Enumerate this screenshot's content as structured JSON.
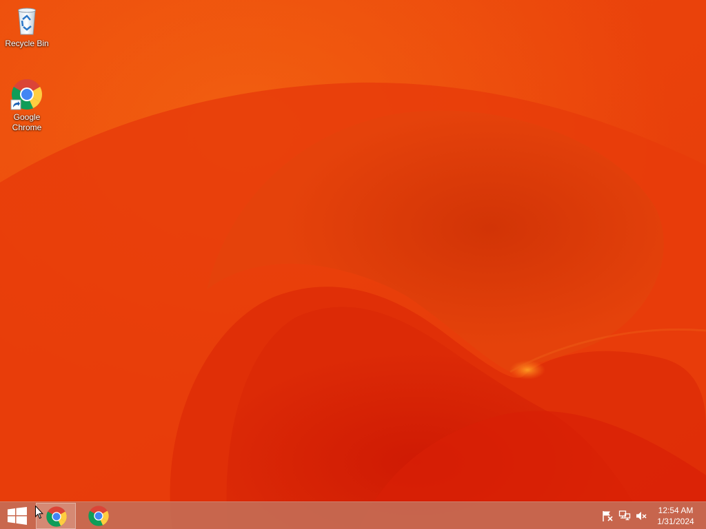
{
  "desktop": {
    "icons": [
      {
        "label": "Recycle Bin",
        "icon": "recycle-bin-icon"
      },
      {
        "label": "Google\nChrome",
        "icon": "chrome-icon",
        "shortcut": true
      }
    ],
    "wallpaper_colors": {
      "base": "#e9400c",
      "light": "#f26b14",
      "dark": "#cf1c04",
      "deep": "#d42204"
    }
  },
  "taskbar": {
    "start_icon": "windows-logo-icon",
    "pinned": [
      {
        "app": "Google Chrome",
        "icon": "chrome-icon",
        "active": true
      },
      {
        "app": "Google Chrome",
        "icon": "chrome-icon",
        "active": false
      }
    ],
    "tray": {
      "icons": [
        "action-center-flag-icon",
        "network-icon",
        "volume-muted-icon"
      ],
      "time": "12:54 AM",
      "date": "1/31/2024"
    },
    "color": "#c46e58"
  }
}
